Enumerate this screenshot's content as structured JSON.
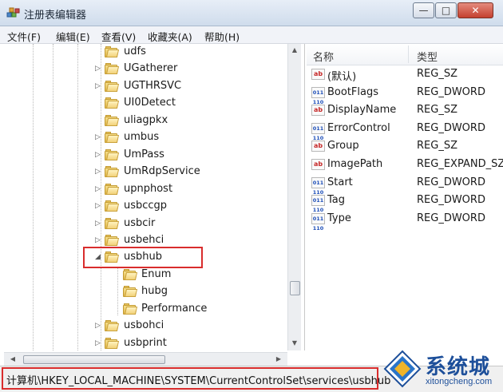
{
  "window": {
    "title": "注册表编辑器",
    "min_glyph": "—",
    "max_glyph": "□",
    "close_glyph": "✕"
  },
  "menu": [
    "文件(F)",
    "编辑(E)",
    "查看(V)",
    "收藏夹(A)",
    "帮助(H)"
  ],
  "tree": {
    "nodes": [
      {
        "label": "udfs",
        "expander": "",
        "level": 1
      },
      {
        "label": "UGatherer",
        "expander": "▷",
        "level": 1
      },
      {
        "label": "UGTHRSVC",
        "expander": "▷",
        "level": 1
      },
      {
        "label": "UI0Detect",
        "expander": "",
        "level": 1
      },
      {
        "label": "uliagpkx",
        "expander": "",
        "level": 1
      },
      {
        "label": "umbus",
        "expander": "▷",
        "level": 1
      },
      {
        "label": "UmPass",
        "expander": "▷",
        "level": 1
      },
      {
        "label": "UmRdpService",
        "expander": "▷",
        "level": 1
      },
      {
        "label": "upnphost",
        "expander": "▷",
        "level": 1
      },
      {
        "label": "usbccgp",
        "expander": "▷",
        "level": 1
      },
      {
        "label": "usbcir",
        "expander": "▷",
        "level": 1
      },
      {
        "label": "usbehci",
        "expander": "▷",
        "level": 1
      },
      {
        "label": "usbhub",
        "expander": "◢",
        "level": 1,
        "selected": true
      },
      {
        "label": "Enum",
        "expander": "",
        "level": 2
      },
      {
        "label": "hubg",
        "expander": "",
        "level": 2
      },
      {
        "label": "Performance",
        "expander": "",
        "level": 2
      },
      {
        "label": "usbohci",
        "expander": "▷",
        "level": 1
      },
      {
        "label": "usbprint",
        "expander": "▷",
        "level": 1
      }
    ]
  },
  "values": {
    "columns": {
      "name": "名称",
      "type": "类型"
    },
    "rows": [
      {
        "name": "(默认)",
        "type": "REG_SZ",
        "icon": "ab-icon",
        "icon_text": "ab"
      },
      {
        "name": "BootFlags",
        "type": "REG_DWORD",
        "icon": "binary-icon",
        "icon_text": "011\n110"
      },
      {
        "name": "DisplayName",
        "type": "REG_SZ",
        "icon": "ab-icon",
        "icon_text": "ab"
      },
      {
        "name": "ErrorControl",
        "type": "REG_DWORD",
        "icon": "binary-icon",
        "icon_text": "011\n110"
      },
      {
        "name": "Group",
        "type": "REG_SZ",
        "icon": "ab-icon",
        "icon_text": "ab"
      },
      {
        "name": "ImagePath",
        "type": "REG_EXPAND_SZ",
        "icon": "ab-icon",
        "icon_text": "ab"
      },
      {
        "name": "Start",
        "type": "REG_DWORD",
        "icon": "binary-icon",
        "icon_text": "011\n110"
      },
      {
        "name": "Tag",
        "type": "REG_DWORD",
        "icon": "binary-icon",
        "icon_text": "011\n110"
      },
      {
        "name": "Type",
        "type": "REG_DWORD",
        "icon": "binary-icon",
        "icon_text": "011\n110"
      }
    ]
  },
  "statusbar": {
    "path": "计算机\\HKEY_LOCAL_MACHINE\\SYSTEM\\CurrentControlSet\\services\\usbhub"
  },
  "watermark": {
    "name": "系统城",
    "url": "xitongcheng.com"
  },
  "colors": {
    "highlight": "#d92d2d",
    "folder": "#f2d27a",
    "watermark": "#1d4f9a"
  }
}
